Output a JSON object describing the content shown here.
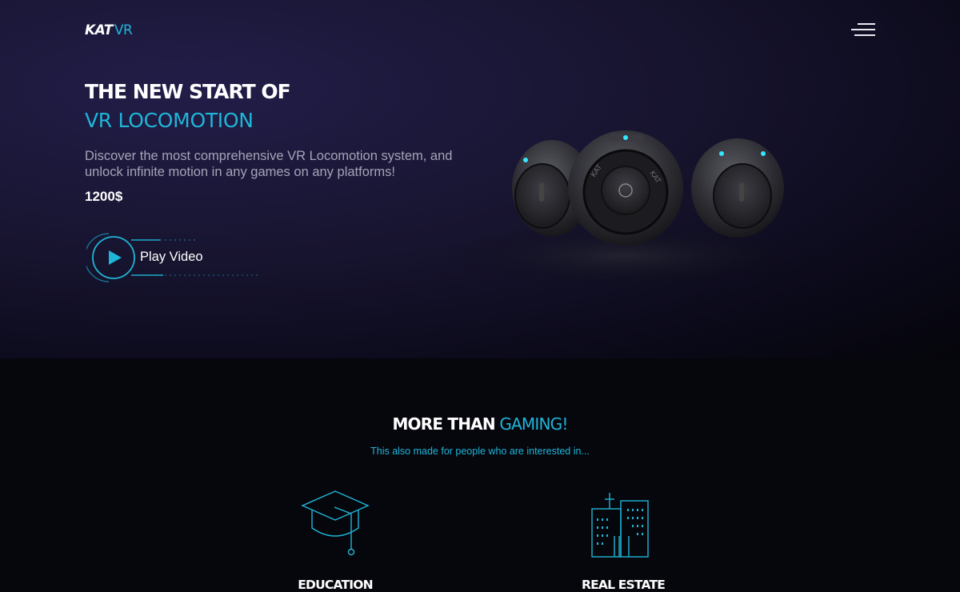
{
  "header": {
    "logo_primary": "KAT",
    "logo_secondary": "VR",
    "menu_icon": "hamburger-menu-icon"
  },
  "hero": {
    "title_line1": "THE NEW START OF",
    "title_line2": "VR LOCOMOTION",
    "description": "Discover the most comprehensive VR Locomotion system, and unlock infinite motion in any games on any platforms!",
    "price": "1200$",
    "play_label": "Play Video",
    "play_icon": "play-icon",
    "product_brand": "KAT"
  },
  "section": {
    "title_white": "MORE THAN",
    "title_accent": "GAMING!",
    "subtitle": "This also made for people who are interested in...",
    "features": [
      {
        "label": "EDUCATION",
        "icon": "graduation-cap-icon"
      },
      {
        "label": "REAL ESTATE",
        "icon": "buildings-icon"
      }
    ]
  },
  "colors": {
    "accent": "#1fb6d8",
    "hero_bg": "#1a1636",
    "page_bg": "#06060d",
    "text_muted": "#a4a4b6"
  }
}
